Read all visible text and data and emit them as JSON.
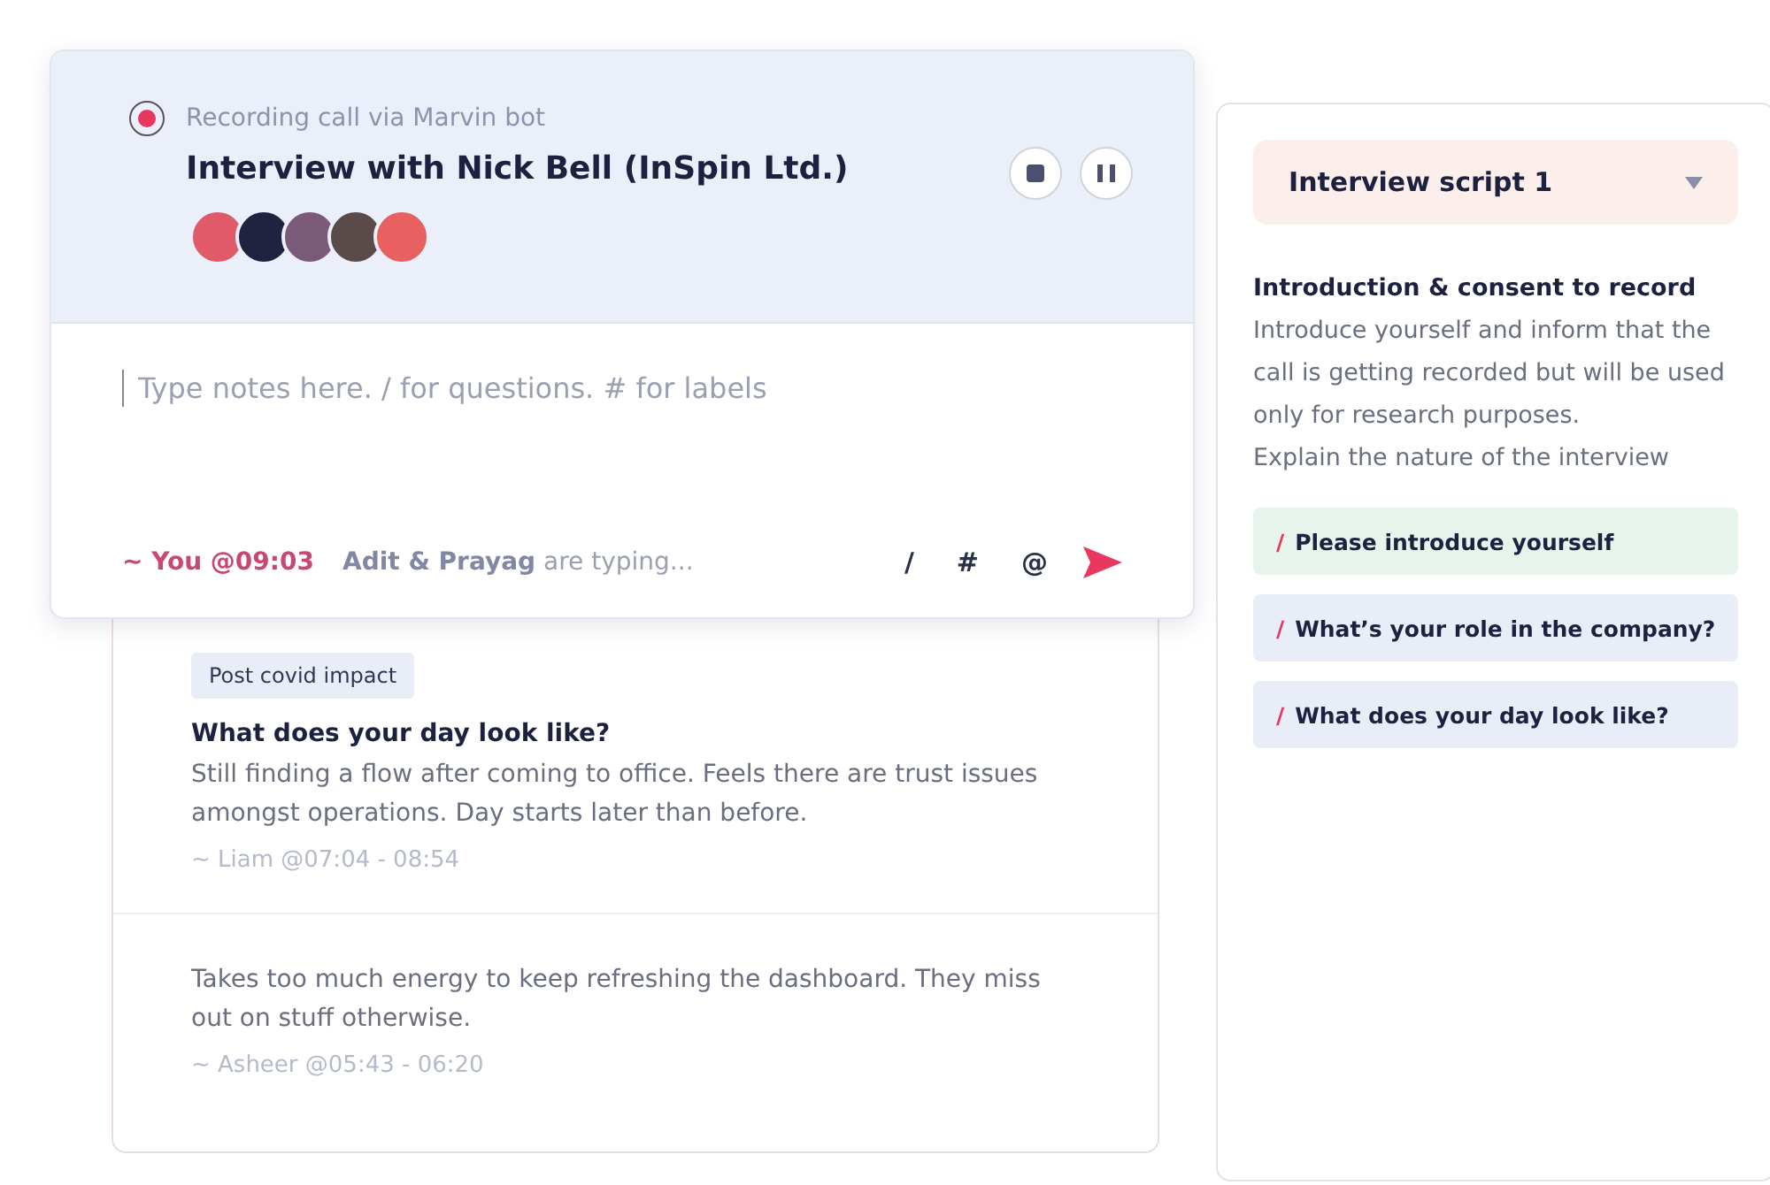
{
  "recording": {
    "status": "Recording call via Marvin bot",
    "recording": true,
    "title": "Interview with Nick Bell (InSpin Ltd.)",
    "participants": [
      {
        "color": "#e05a6a"
      },
      {
        "color": "#1f2340"
      },
      {
        "color": "#7a5a78"
      },
      {
        "color": "#5a4a4a"
      },
      {
        "color": "#e86060"
      }
    ],
    "editor": {
      "placeholder": "Type notes here. / for questions. # for labels"
    },
    "author": "~ You @09:03",
    "typing_names": "Adit & Prayag",
    "typing_suffix": "are typing...",
    "shortcuts": [
      "/",
      "#",
      "@"
    ]
  },
  "notes": [
    {
      "tag": "Post covid impact",
      "question": "What does your day look like?",
      "text": "Still finding a flow after coming to office. Feels there are trust issues amongst operations. Day starts later than before.",
      "meta": "~ Liam @07:04 - 08:54"
    },
    {
      "text": "Takes too much energy to keep refreshing the dashboard. They miss out on stuff otherwise.",
      "meta": "~ Asheer @05:43 - 06:20"
    }
  ],
  "script": {
    "selector": "Interview script 1",
    "section_title": "Introduction & consent to record",
    "section_lines": [
      "Introduce yourself and inform that the call is getting recorded but will be used only for research purposes.",
      "Explain the nature of the interview"
    ],
    "questions": [
      {
        "prefix": "/",
        "label": "Please introduce yourself",
        "asked": true
      },
      {
        "prefix": "/",
        "label": "What’s your role in the company?",
        "asked": false
      },
      {
        "prefix": "/",
        "label": "What does your day look like?",
        "asked": false
      }
    ]
  }
}
